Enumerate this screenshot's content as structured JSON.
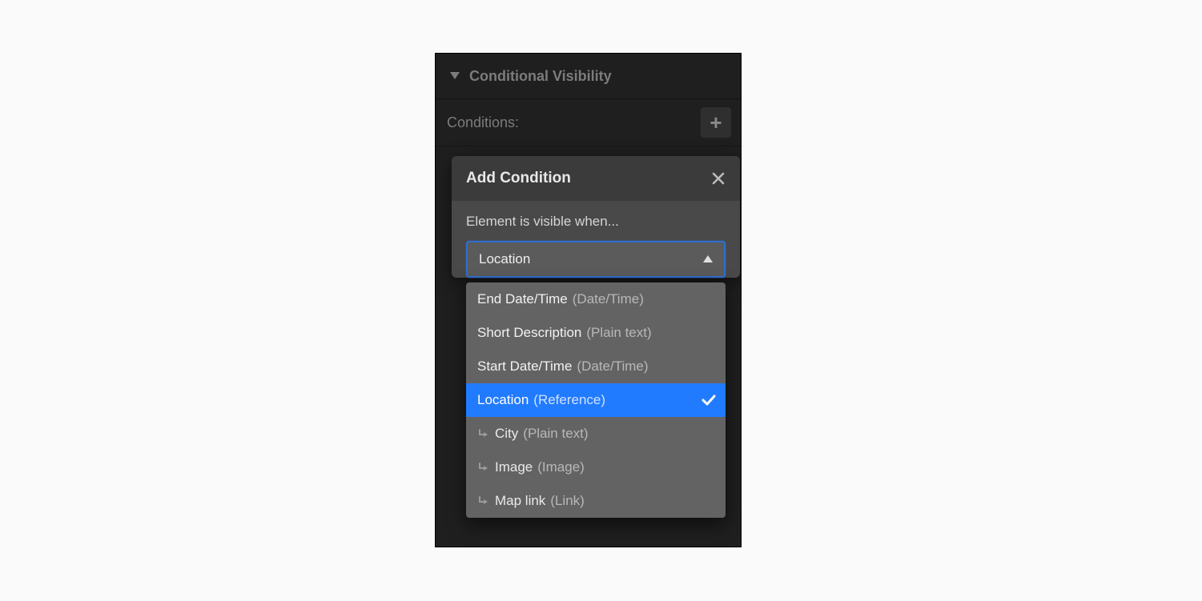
{
  "section": {
    "title": "Conditional Visibility",
    "conditions_label": "Conditions:"
  },
  "popover": {
    "title": "Add Condition",
    "prompt": "Element is visible when...",
    "select_value": "Location",
    "close_label": "Close"
  },
  "dropdown": {
    "options": [
      {
        "name": "End Date/Time",
        "type": "(Date/Time)",
        "child": false,
        "selected": false
      },
      {
        "name": "Short Description",
        "type": "(Plain text)",
        "child": false,
        "selected": false
      },
      {
        "name": "Start Date/Time",
        "type": "(Date/Time)",
        "child": false,
        "selected": false
      },
      {
        "name": "Location",
        "type": "(Reference)",
        "child": false,
        "selected": true
      },
      {
        "name": "City",
        "type": "(Plain text)",
        "child": true,
        "selected": false
      },
      {
        "name": "Image",
        "type": "(Image)",
        "child": true,
        "selected": false
      },
      {
        "name": "Map link",
        "type": "(Link)",
        "child": true,
        "selected": false
      }
    ]
  }
}
